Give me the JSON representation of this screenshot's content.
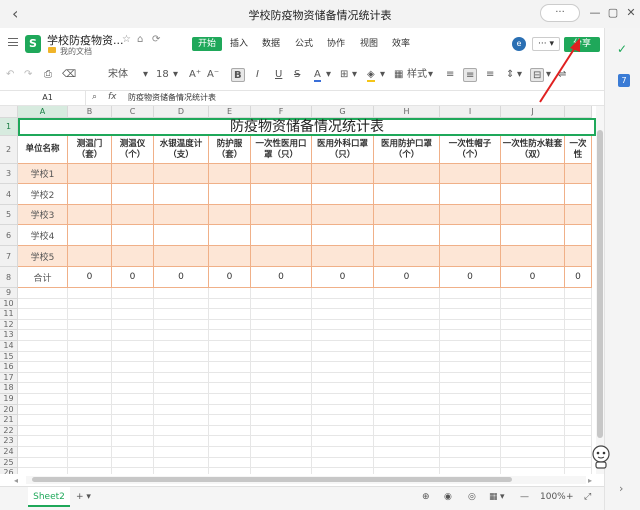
{
  "window": {
    "title": "学校防疫物资储备情况统计表",
    "controls": [
      "···",
      "—",
      "▢",
      "✕"
    ]
  },
  "header": {
    "doc_icon_letter": "S",
    "doc_name": "学校防疫物资...",
    "doc_location": "我的文档",
    "tabs": [
      "开始",
      "插入",
      "数据",
      "公式",
      "协作",
      "视图",
      "效率"
    ],
    "active_tab": "开始",
    "more_label": "··· ▾",
    "share_label": "分享"
  },
  "toolbar": {
    "font_name": "宋体",
    "font_size": "18",
    "style_label": "样式"
  },
  "formula_bar": {
    "cell_ref": "A1",
    "fx": "fx",
    "content": "防疫物资储备情况统计表"
  },
  "columns": [
    "A",
    "B",
    "C",
    "D",
    "E",
    "F",
    "G",
    "H",
    "I",
    "J"
  ],
  "selected_column": "A",
  "row_numbers": [
    "1",
    "2",
    "3",
    "4",
    "5",
    "6",
    "7",
    "8",
    "9",
    "10",
    "11",
    "12",
    "13",
    "14",
    "15",
    "16",
    "17",
    "18",
    "19",
    "20",
    "21",
    "22",
    "23",
    "24",
    "25",
    "26",
    "27",
    "28",
    "29",
    "30"
  ],
  "sheet": {
    "title": "防疫物资储备情况统计表",
    "headers": [
      "单位名称",
      "测温门（套）",
      "测温仪（个）",
      "水银温度计（支）",
      "防护服（套）",
      "一次性医用口罩（只）",
      "医用外科口罩（只）",
      "医用防护口罩（个）",
      "一次性帽子（个）",
      "一次性防水鞋套（双）",
      "一次性"
    ],
    "rows": [
      [
        "学校1",
        "",
        "",
        "",
        "",
        "",
        "",
        "",
        "",
        "",
        ""
      ],
      [
        "学校2",
        "",
        "",
        "",
        "",
        "",
        "",
        "",
        "",
        "",
        ""
      ],
      [
        "学校3",
        "",
        "",
        "",
        "",
        "",
        "",
        "",
        "",
        "",
        ""
      ],
      [
        "学校4",
        "",
        "",
        "",
        "",
        "",
        "",
        "",
        "",
        "",
        ""
      ],
      [
        "学校5",
        "",
        "",
        "",
        "",
        "",
        "",
        "",
        "",
        "",
        ""
      ],
      [
        "合计",
        "0",
        "0",
        "0",
        "0",
        "0",
        "0",
        "0",
        "0",
        "0",
        "0"
      ]
    ]
  },
  "bottom": {
    "sheet_tab": "Sheet2",
    "add": "+ ▾",
    "zoom": "100%",
    "zoom_minus": "—",
    "zoom_plus": "+"
  },
  "colors": {
    "accent": "#1fa85a",
    "peach": "#fde6d6",
    "border": "#f0b088",
    "arrow": "#e02020"
  }
}
